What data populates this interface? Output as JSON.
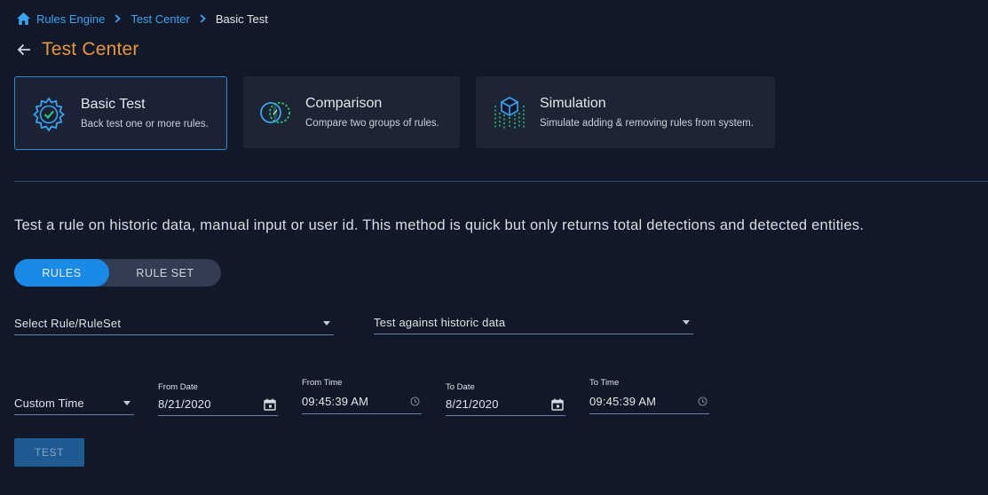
{
  "breadcrumb": {
    "items": [
      "Rules Engine",
      "Test Center"
    ],
    "current": "Basic Test"
  },
  "header": {
    "title": "Test Center"
  },
  "cards": [
    {
      "title": "Basic Test",
      "description": "Back test one or more rules.",
      "selected": true
    },
    {
      "title": "Comparison",
      "description": "Compare two groups of rules.",
      "selected": false
    },
    {
      "title": "Simulation",
      "description": "Simulate adding & removing rules from system.",
      "selected": false
    }
  ],
  "description": "Test a rule on historic data, manual input or user id. This method is quick but only returns total detections and detected entities.",
  "toggle": {
    "options": [
      "RULES",
      "RULE SET"
    ],
    "selected": "RULES"
  },
  "form": {
    "rule_select": "Select Rule/RuleSet",
    "source_select": "Test against historic data",
    "time_mode_select": "Custom Time",
    "from_date": {
      "label": "From Date",
      "value": "8/21/2020"
    },
    "from_time": {
      "label": "From Time",
      "value": "09:45:39 AM"
    },
    "to_date": {
      "label": "To Date",
      "value": "8/21/2020"
    },
    "to_time": {
      "label": "To Time",
      "value": "09:45:39 AM"
    }
  },
  "actions": {
    "test_label": "TEST"
  },
  "colors": {
    "accent": "#1a8ae6",
    "title": "#e8963a",
    "background": "#111827",
    "card": "#1d2433"
  }
}
